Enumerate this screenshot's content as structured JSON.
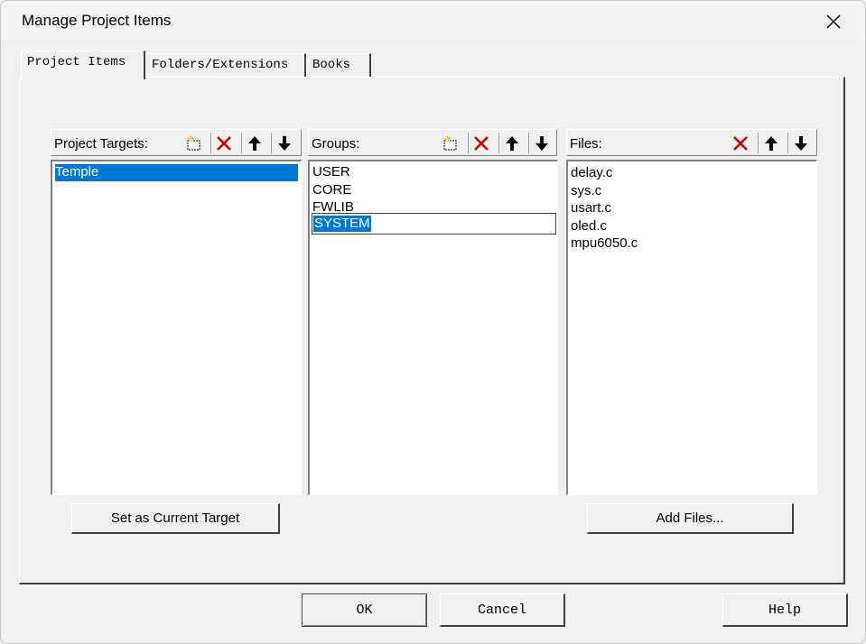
{
  "window": {
    "title": "Manage Project Items"
  },
  "tabs": [
    {
      "label": "Project Items",
      "active": true
    },
    {
      "label": "Folders/Extensions",
      "active": false
    },
    {
      "label": "Books",
      "active": false
    }
  ],
  "targets": {
    "label": "Project Targets:",
    "items": [
      "Temple"
    ],
    "selected": "Temple"
  },
  "groups": {
    "label": "Groups:",
    "items": [
      "USER",
      "CORE",
      "FWLIB",
      "SYSTEM"
    ],
    "editing": "SYSTEM"
  },
  "files": {
    "label": "Files:",
    "items": [
      "delay.c",
      "sys.c",
      "usart.c",
      "oled.c",
      "mpu6050.c"
    ]
  },
  "buttons": {
    "set_current_target": "Set as Current Target",
    "add_files": "Add Files...",
    "ok": "OK",
    "cancel": "Cancel",
    "help": "Help"
  },
  "icons": [
    "new-icon",
    "delete-icon",
    "move-up-icon",
    "move-down-icon",
    "close-icon"
  ],
  "colors": {
    "selection": "#0078d7",
    "delete": "#cc0000",
    "face": "#f0f0f0"
  }
}
